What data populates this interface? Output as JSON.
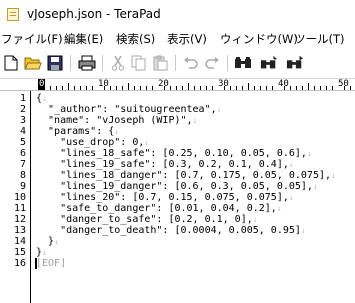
{
  "window": {
    "title": "vJoseph.json - TeraPad"
  },
  "menu": {
    "items": [
      {
        "label": "ファイル(F)"
      },
      {
        "label": "編集(E)"
      },
      {
        "label": "検索(S)"
      },
      {
        "label": "表示(V)"
      },
      {
        "label": "ウィンドウ(W)"
      },
      {
        "label": "ツール(T)"
      }
    ]
  },
  "toolbar": {
    "icons": [
      "new-file-icon",
      "open-folder-icon",
      "save-icon",
      "print-icon",
      "cut-icon",
      "copy-icon",
      "paste-icon",
      "undo-icon",
      "redo-icon",
      "find-icon",
      "find-next-icon",
      "find-prev-icon"
    ]
  },
  "ruler": {
    "zero": "0",
    "labels": [
      "10",
      "20",
      "30",
      "40",
      "50"
    ]
  },
  "editor": {
    "eol_mark": "↓",
    "eof_mark": "[EOF]",
    "lines": [
      "{",
      "  \"_author\": \"suitougreentea\",",
      "  \"name\": \"vJoseph (WIP)\",",
      "  \"params\": {",
      "    \"use_drop\": 0,",
      "    \"lines_18_safe\": [0.25, 0.10, 0.05, 0.6],",
      "    \"lines_19_safe\": [0.3, 0.2, 0.1, 0.4],",
      "    \"lines_18_danger\": [0.7, 0.175, 0.05, 0.075],",
      "    \"lines_19_danger\": [0.6, 0.3, 0.05, 0.05],",
      "    \"lines_20\": [0.7, 0.15, 0.075, 0.075],",
      "    \"safe_to_danger\": [0.01, 0.04, 0.2],",
      "    \"danger_to_safe\": [0.2, 0.1, 0],",
      "    \"danger_to_death\": [0.0004, 0.005, 0.95]",
      "  }",
      "}",
      ""
    ]
  }
}
